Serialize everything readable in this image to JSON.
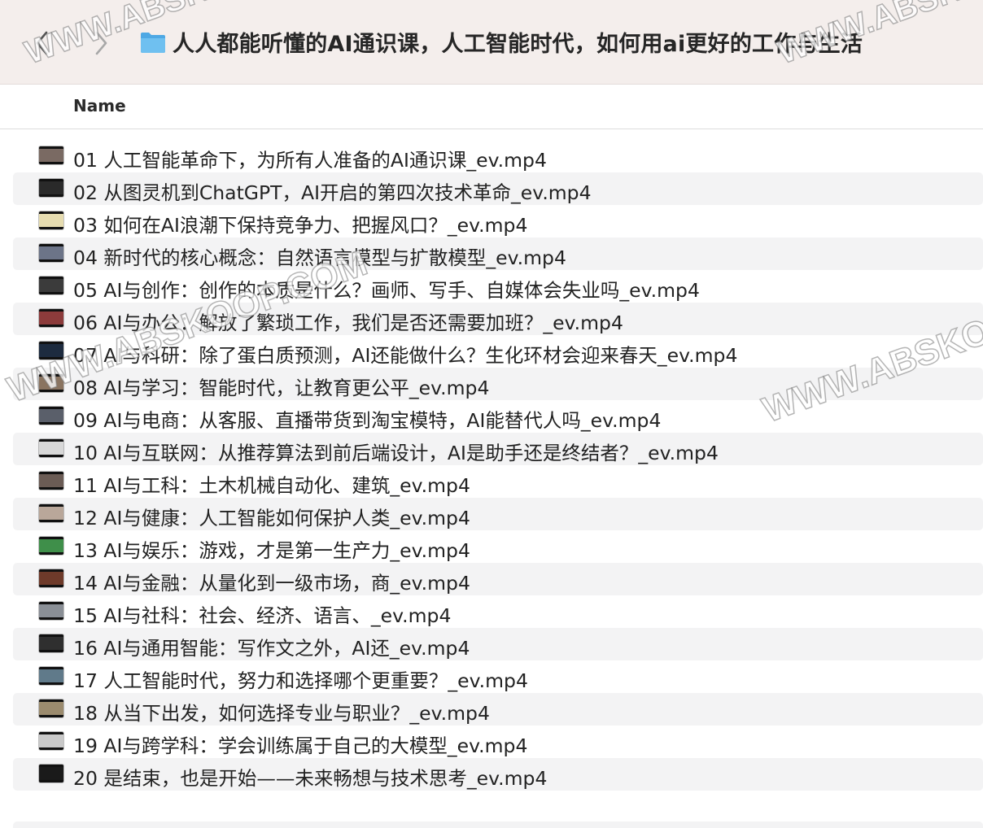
{
  "toolbar": {
    "title": "人人都能听懂的AI通识课，人工智能时代，如何用ai更好的工作与生活",
    "back_icon": "chevron-left-icon",
    "forward_icon": "chevron-right-icon",
    "folder_icon": "folder-icon",
    "folder_color": "#5fb4ea"
  },
  "header": {
    "name_label": "Name"
  },
  "files": [
    {
      "name": "01 人工智能革命下，为所有人准备的AI通识课_ev.mp4",
      "thumb_color": "#7a6a63"
    },
    {
      "name": "02 从图灵机到ChatGPT，AI开启的第四次技术革命_ev.mp4",
      "thumb_color": "#2a2a2a"
    },
    {
      "name": "03 如何在AI浪潮下保持竞争力、把握风口？_ev.mp4",
      "thumb_color": "#e6dcb0"
    },
    {
      "name": "04 新时代的核心概念：自然语言模型与扩散模型_ev.mp4",
      "thumb_color": "#6c7488"
    },
    {
      "name": "05 AI与创作：创作的本质是什么？画师、写手、自媒体会失业吗_ev.mp4",
      "thumb_color": "#3b3b3b"
    },
    {
      "name": "06 AI与办公：解放了繁琐工作，我们是否还需要加班？_ev.mp4",
      "thumb_color": "#8c3b3b"
    },
    {
      "name": "07 AI与科研：除了蛋白质预测，AI还能做什么？生化环材会迎来春天_ev.mp4",
      "thumb_color": "#1d2b3f"
    },
    {
      "name": "08 AI与学习：智能时代，让教育更公平_ev.mp4",
      "thumb_color": "#8a7460"
    },
    {
      "name": "09 AI与电商：从客服、直播带货到淘宝模特，AI能替代人吗_ev.mp4",
      "thumb_color": "#5a5f6a"
    },
    {
      "name": "10 AI与互联网：从推荐算法到前后端设计，AI是助手还是终结者？_ev.mp4",
      "thumb_color": "#d8d8d8"
    },
    {
      "name": "11 AI与工科：土木机械自动化、建筑_ev.mp4",
      "thumb_color": "#6b5c55"
    },
    {
      "name": "12 AI与健康：人工智能如何保护人类_ev.mp4",
      "thumb_color": "#b9a79a"
    },
    {
      "name": "13 AI与娱乐：游戏，才是第一生产力_ev.mp4",
      "thumb_color": "#3f8f4a"
    },
    {
      "name": "14 AI与金融：从量化到一级市场，商_ev.mp4",
      "thumb_color": "#6e3a2a"
    },
    {
      "name": "15 AI与社科：社会、经济、语言、_ev.mp4",
      "thumb_color": "#8a8f96"
    },
    {
      "name": "16 AI与通用智能：写作文之外，AI还_ev.mp4",
      "thumb_color": "#2f2f2f"
    },
    {
      "name": "17 人工智能时代，努力和选择哪个更重要？_ev.mp4",
      "thumb_color": "#607a8a"
    },
    {
      "name": "18 从当下出发，如何选择专业与职业？_ev.mp4",
      "thumb_color": "#9b8b6e"
    },
    {
      "name": "19 AI与跨学科：学会训练属于自己的大模型_ev.mp4",
      "thumb_color": "#c9c9c9"
    },
    {
      "name": "20 是结束，也是开始——未来畅想与技术思考_ev.mp4",
      "thumb_color": "#1a1a1a"
    }
  ],
  "watermarks": [
    "WWW.ABSKOOP.COM",
    "WWW.ABSKOOP.COM",
    "WWW.ABSKOOP.COM",
    "WWW.ABSKOOP.COM"
  ]
}
